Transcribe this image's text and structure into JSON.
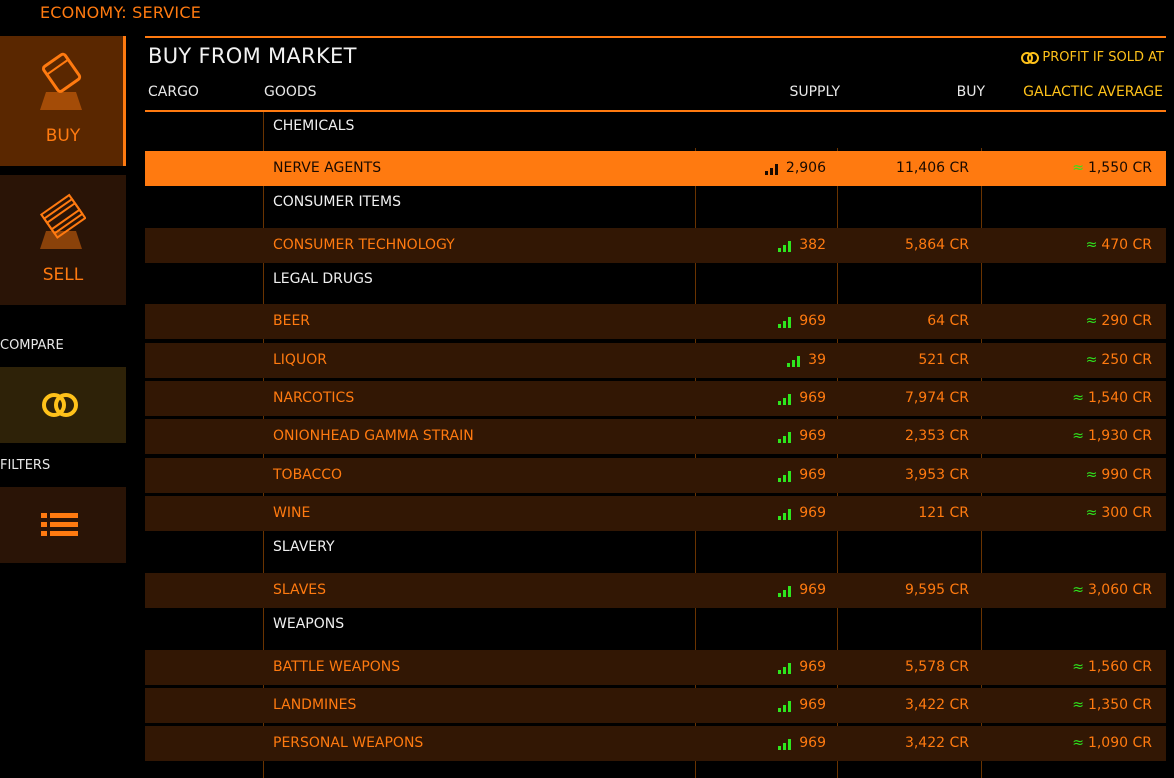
{
  "economy": "ECONOMY: SERVICE",
  "sidebar": {
    "buy_label": "BUY",
    "sell_label": "SELL",
    "compare_label": "COMPARE",
    "filters_label": "FILTERS"
  },
  "panel": {
    "title": "BUY FROM MARKET",
    "profit_label": "PROFIT IF SOLD AT",
    "columns": {
      "cargo": "CARGO",
      "goods": "GOODS",
      "supply": "SUPPLY",
      "buy": "BUY",
      "galactic": "GALACTIC AVERAGE"
    }
  },
  "colors": {
    "accent": "#ff7a10",
    "profit": "#ffc21a",
    "signal_green": "#2ee51e",
    "selected_row": "#ff7a10",
    "item_row": "#321704"
  },
  "categories": {
    "chemicals": "CHEMICALS",
    "consumer": "CONSUMER ITEMS",
    "drugs": "LEGAL DRUGS",
    "slavery": "SLAVERY",
    "weapons": "WEAPONS"
  },
  "rows": [
    {
      "goods": "NERVE AGENTS",
      "supply": "2,906",
      "buy": "11,406 CR",
      "approx": "≈",
      "galactic": "1,550 CR",
      "selected": true
    },
    {
      "goods": "CONSUMER TECHNOLOGY",
      "supply": "382",
      "buy": "5,864 CR",
      "approx": "≈",
      "galactic": "470 CR"
    },
    {
      "goods": "BEER",
      "supply": "969",
      "buy": "64 CR",
      "approx": "≈",
      "galactic": "290 CR"
    },
    {
      "goods": "LIQUOR",
      "supply": "39",
      "buy": "521 CR",
      "approx": "≈",
      "galactic": "250 CR"
    },
    {
      "goods": "NARCOTICS",
      "supply": "969",
      "buy": "7,974 CR",
      "approx": "≈",
      "galactic": "1,540 CR"
    },
    {
      "goods": "ONIONHEAD GAMMA STRAIN",
      "supply": "969",
      "buy": "2,353 CR",
      "approx": "≈",
      "galactic": "1,930 CR"
    },
    {
      "goods": "TOBACCO",
      "supply": "969",
      "buy": "3,953 CR",
      "approx": "≈",
      "galactic": "990 CR"
    },
    {
      "goods": "WINE",
      "supply": "969",
      "buy": "121 CR",
      "approx": "≈",
      "galactic": "300 CR"
    },
    {
      "goods": "SLAVES",
      "supply": "969",
      "buy": "9,595 CR",
      "approx": "≈",
      "galactic": "3,060 CR"
    },
    {
      "goods": "BATTLE WEAPONS",
      "supply": "969",
      "buy": "5,578 CR",
      "approx": "≈",
      "galactic": "1,560 CR"
    },
    {
      "goods": "LANDMINES",
      "supply": "969",
      "buy": "3,422 CR",
      "approx": "≈",
      "galactic": "1,350 CR"
    },
    {
      "goods": "PERSONAL WEAPONS",
      "supply": "969",
      "buy": "3,422 CR",
      "approx": "≈",
      "galactic": "1,090 CR"
    }
  ]
}
